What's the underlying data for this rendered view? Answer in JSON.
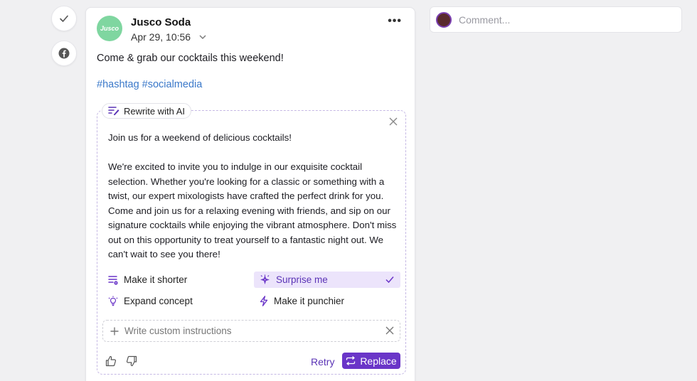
{
  "rail": {
    "approve_icon": "check-icon",
    "network_icon": "facebook-icon"
  },
  "post": {
    "account_name": "Jusco Soda",
    "avatar_text": "Jusco",
    "date": "Apr 29, 10:56",
    "more_label": "•••",
    "text": "Come & grab our cocktails this weekend!",
    "hashtags": [
      "#hashtag",
      "#socialmedia"
    ]
  },
  "ai": {
    "tag_label": "Rewrite with AI",
    "paragraph1": "Join us for a weekend of delicious cocktails!",
    "paragraph2": "We're excited to invite you to indulge in our exquisite cocktail selection. Whether you're looking for a classic or something with a twist, our expert mixologists have crafted the perfect drink for you. Come and join us for a relaxing evening with friends, and sip on our signature cocktails while enjoying the vibrant atmosphere. Don't miss out on this opportunity to treat yourself to a fantastic night out. We can't wait to see you there!",
    "options": [
      {
        "label": "Make it shorter",
        "selected": false
      },
      {
        "label": "Surprise me",
        "selected": true
      },
      {
        "label": "Expand concept",
        "selected": false
      },
      {
        "label": "Make it punchier",
        "selected": false
      }
    ],
    "custom_placeholder": "Write custom instructions",
    "retry_label": "Retry",
    "replace_label": "Replace"
  },
  "comment": {
    "placeholder": "Comment..."
  },
  "colors": {
    "accent": "#6a35c8",
    "selected_bg": "#ece4fb",
    "hashtag": "#3a78c9"
  }
}
